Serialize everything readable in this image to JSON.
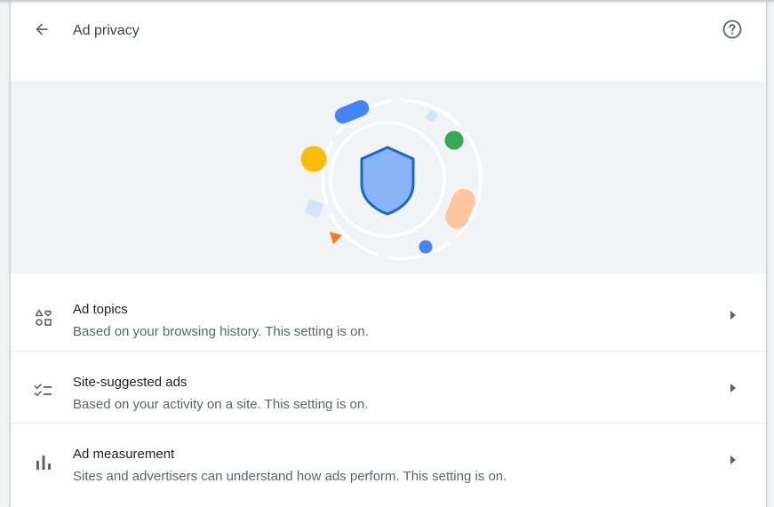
{
  "header": {
    "title": "Ad privacy",
    "back_icon": "arrow-back-icon",
    "help_icon": "help-circle-icon"
  },
  "banner": {
    "illustration": "shield-orbit-illustration",
    "colors": {
      "background": "#f1f3f4",
      "shield_fill": "#8ab4f8",
      "shield_stroke": "#1967d2",
      "blue": "#4285f4",
      "green": "#34a853",
      "yellow": "#fbbc04",
      "peach": "#fdc69c",
      "orange": "#fa7b17",
      "light_blue": "#d2e3fc"
    }
  },
  "settings": [
    {
      "title": "Ad topics",
      "subtitle": "Based on your browsing history. This setting is on.",
      "icon": "ad-topics-icon"
    },
    {
      "title": "Site-suggested ads",
      "subtitle": "Based on your activity on a site. This setting is on.",
      "icon": "checklist-icon"
    },
    {
      "title": "Ad measurement",
      "subtitle": "Sites and advertisers can understand how ads perform. This setting is on.",
      "icon": "bar-chart-icon"
    }
  ],
  "colors": {
    "text_primary": "#202124",
    "text_secondary": "#5f6368",
    "icon": "#5f6368",
    "divider": "#e8eaed"
  }
}
